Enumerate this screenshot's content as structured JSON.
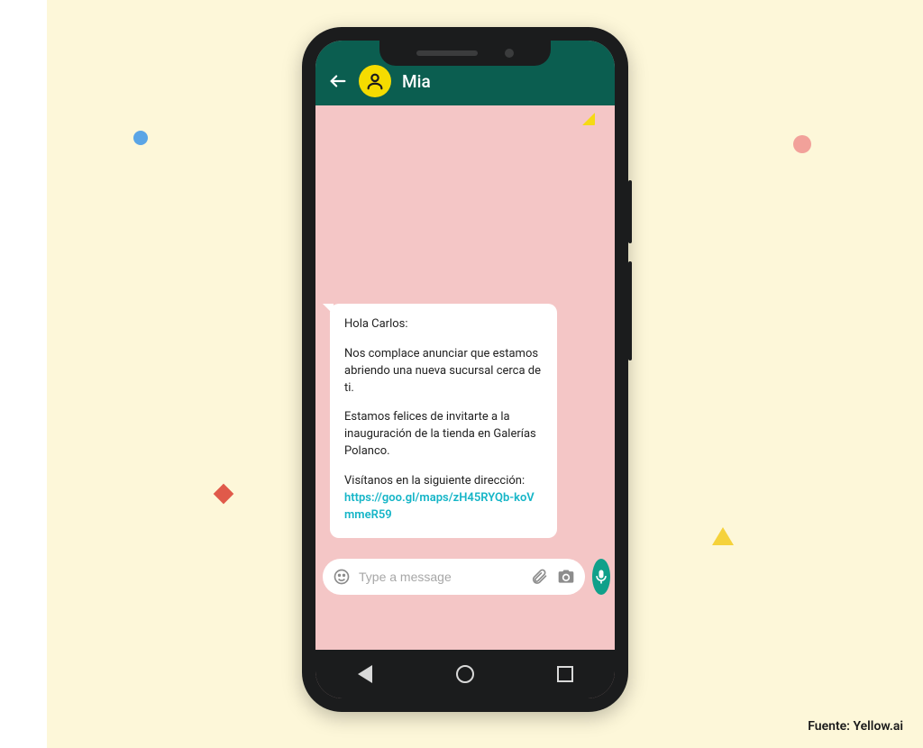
{
  "contact_name": "Mia",
  "message": {
    "greeting": "Hola Carlos:",
    "paragraph1": "Nos complace anunciar que estamos abriendo una nueva sucursal cerca de ti.",
    "paragraph2": "Estamos felices de invitarte a la inauguración de la tienda en Galerías Polanco.",
    "paragraph3_prefix": "Visítanos en la siguiente dirección:",
    "link_text": "https://goo.gl/maps/zH45RYQb-koVmmeR59"
  },
  "input_placeholder": "Type a message",
  "source_credit": "Fuente: Yellow.ai"
}
